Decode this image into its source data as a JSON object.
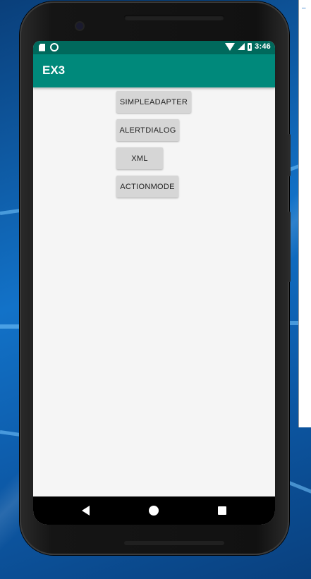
{
  "status_bar": {
    "time": "3:46",
    "icons": [
      "sd-card-icon",
      "sync-icon",
      "wifi-icon",
      "signal-icon",
      "battery-icon"
    ]
  },
  "app_bar": {
    "title": "EX3",
    "color": "#00897b",
    "status_color": "#00695c"
  },
  "buttons": [
    {
      "label": "SIMPLEADAPTER"
    },
    {
      "label": "ALERTDIALOG"
    },
    {
      "label": "XML"
    },
    {
      "label": "ACTIONMODE"
    }
  ],
  "nav_bar": {
    "icons": [
      "back-icon",
      "home-icon",
      "recents-icon"
    ]
  }
}
